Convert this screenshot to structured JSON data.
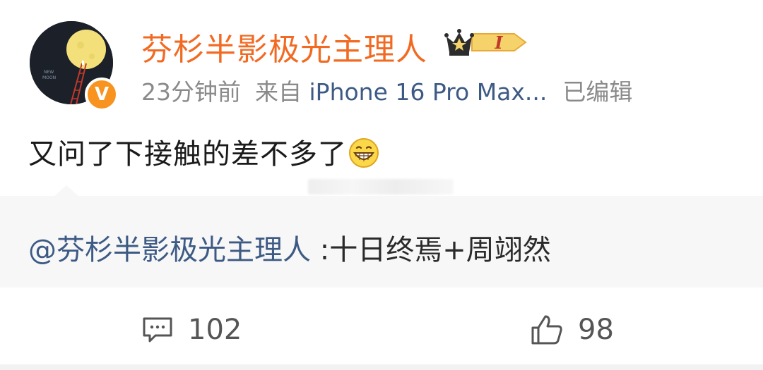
{
  "post": {
    "author": "芬杉半影极光主理人",
    "fan_level": "I",
    "time": "23分钟前",
    "source_prefix": "来自",
    "device": "iPhone 16 Pro Max...",
    "edited": "已编辑",
    "verified_badge": "V",
    "text": "又问了下接触的差不多了",
    "emoji_icon": "grin-emoji-icon"
  },
  "repost": {
    "mention": "@芬杉半影极光主理人",
    "text": " :十日终焉+周翊然"
  },
  "actions": {
    "comment_count": "102",
    "like_count": "98"
  },
  "colors": {
    "author_orange": "#f26a22",
    "link_blue": "#3d5a84",
    "badge_orange": "#f7931e"
  }
}
